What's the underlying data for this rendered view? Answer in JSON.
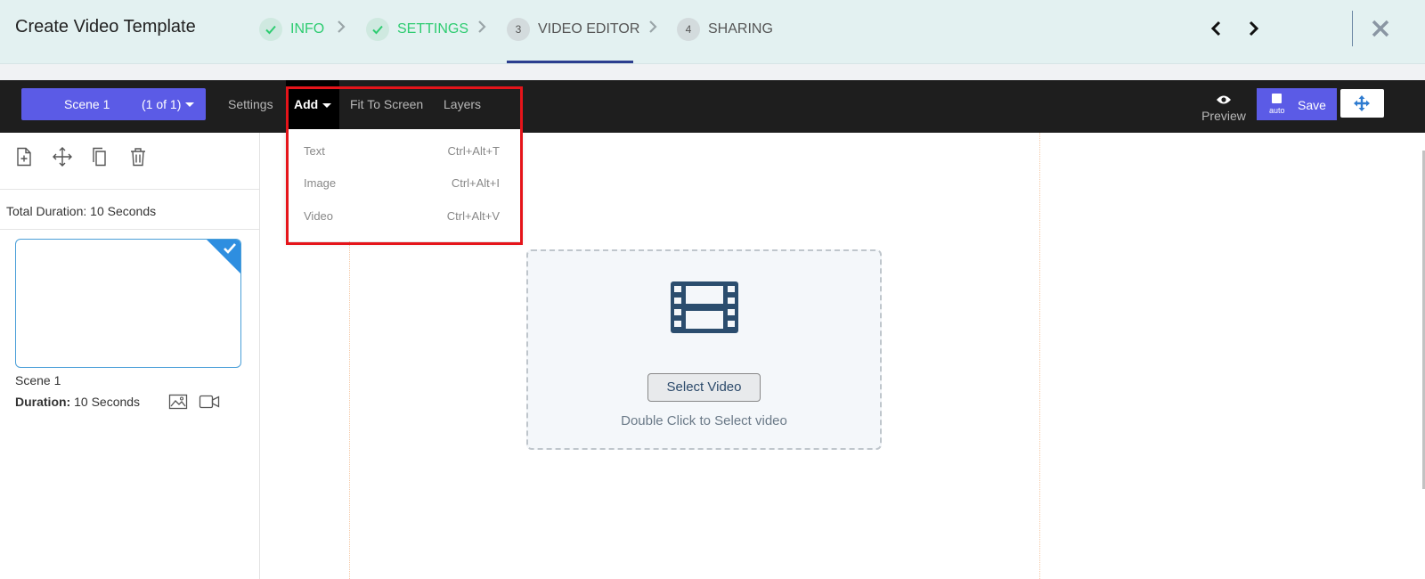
{
  "header": {
    "title": "Create Video Template",
    "steps": [
      {
        "num": "",
        "label": "INFO",
        "state": "done"
      },
      {
        "num": "",
        "label": "SETTINGS",
        "state": "done"
      },
      {
        "num": "3",
        "label": "VIDEO EDITOR",
        "state": "active"
      },
      {
        "num": "4",
        "label": "SHARING",
        "state": "todo"
      }
    ]
  },
  "toolbar": {
    "scene_name": "Scene 1",
    "scene_count": "(1 of 1)",
    "settings_label": "Settings",
    "add_label": "Add",
    "fit_label": "Fit To Screen",
    "layers_label": "Layers",
    "preview_label": "Preview",
    "auto_label": "auto",
    "save_label": "Save"
  },
  "add_menu": {
    "items": [
      {
        "label": "Text",
        "shortcut": "Ctrl+Alt+T"
      },
      {
        "label": "Image",
        "shortcut": "Ctrl+Alt+I"
      },
      {
        "label": "Video",
        "shortcut": "Ctrl+Alt+V"
      }
    ]
  },
  "sidebar": {
    "total_duration": "Total Duration: 10 Seconds",
    "scene": {
      "name": "Scene 1",
      "duration_label": "Duration:",
      "duration_value": "10 Seconds"
    }
  },
  "canvas": {
    "select_button": "Select Video",
    "hint": "Double Click to Select video"
  },
  "colors": {
    "accent": "#5b5be6",
    "done_step": "#2ecc71",
    "highlight": "#e5141a",
    "toolbar_bg": "#1e1e1e"
  }
}
